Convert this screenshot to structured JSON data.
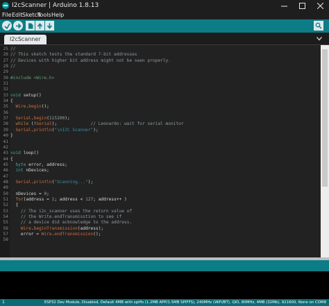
{
  "window": {
    "title": "I2cScanner | Arduino 1.8.13"
  },
  "menu": {
    "items": [
      "File",
      "Edit",
      "Sketch",
      "Tools",
      "Help"
    ]
  },
  "toolbar": {
    "buttons": [
      {
        "name": "verify",
        "icon": "checkmark-icon"
      },
      {
        "name": "upload",
        "icon": "arrow-right-icon"
      },
      {
        "name": "new",
        "icon": "new-file-icon"
      },
      {
        "name": "open",
        "icon": "arrow-up-icon"
      },
      {
        "name": "save",
        "icon": "arrow-down-icon"
      }
    ],
    "right_icon": "serial-monitor-icon"
  },
  "tabs": {
    "active": "I2cScanner"
  },
  "editor": {
    "lines": [
      {
        "n": "25",
        "code": "//",
        "kind": "comment"
      },
      {
        "n": "26",
        "code": "// This sketch tests the standard 7-bit addresses",
        "kind": "comment"
      },
      {
        "n": "27",
        "code": "// Devices with higher bit address might not be seen properly.",
        "kind": "comment"
      },
      {
        "n": "28",
        "code": "//",
        "kind": "comment"
      },
      {
        "n": "29",
        "code": "",
        "kind": "plain"
      },
      {
        "n": "30",
        "code": "#include <Wire.h>",
        "kind": "preproc"
      },
      {
        "n": "31",
        "code": "",
        "kind": "plain"
      },
      {
        "n": "32",
        "code": "",
        "kind": "plain"
      },
      {
        "n": "33",
        "code": "void setup()",
        "kind": "decl"
      },
      {
        "n": "34",
        "code": "{",
        "kind": "plain"
      },
      {
        "n": "35",
        "code": "  Wire.begin();",
        "kind": "call"
      },
      {
        "n": "36",
        "code": "",
        "kind": "plain"
      },
      {
        "n": "37",
        "code": "  Serial.begin(115200);",
        "kind": "call"
      },
      {
        "n": "38",
        "code": "  while (!Serial);             // Leonardo: wait for serial monitor",
        "kind": "loop"
      },
      {
        "n": "39",
        "code": "  Serial.println(\"\\nI2C Scanner\");",
        "kind": "call"
      },
      {
        "n": "40",
        "code": "}",
        "kind": "plain"
      },
      {
        "n": "41",
        "code": "",
        "kind": "plain"
      },
      {
        "n": "42",
        "code": "",
        "kind": "plain"
      },
      {
        "n": "43",
        "code": "void loop()",
        "kind": "decl"
      },
      {
        "n": "44",
        "code": "{",
        "kind": "plain"
      },
      {
        "n": "45",
        "code": "  byte error, address;",
        "kind": "type"
      },
      {
        "n": "46",
        "code": "  int nDevices;",
        "kind": "type"
      },
      {
        "n": "47",
        "code": "",
        "kind": "plain"
      },
      {
        "n": "48",
        "code": "  Serial.println(\"Scanning...\");",
        "kind": "call"
      },
      {
        "n": "49",
        "code": "",
        "kind": "plain"
      },
      {
        "n": "50",
        "code": "  nDevices = 0;",
        "kind": "plain"
      },
      {
        "n": "51",
        "code": "  for(address = 1; address < 127; address++ )",
        "kind": "loop"
      },
      {
        "n": "52",
        "code": "  {",
        "kind": "plain"
      },
      {
        "n": "53",
        "code": "    // The i2c_scanner uses the return value of",
        "kind": "comment"
      },
      {
        "n": "54",
        "code": "    // the Write.endTransmisstion to see if",
        "kind": "comment"
      },
      {
        "n": "55",
        "code": "    // a device did acknowledge to the address.",
        "kind": "comment"
      },
      {
        "n": "56",
        "code": "    Wire.beginTransmission(address);",
        "kind": "call"
      },
      {
        "n": "57",
        "code": "    error = Wire.endTransmission();",
        "kind": "call"
      },
      {
        "n": "58",
        "code": "",
        "kind": "plain"
      }
    ]
  },
  "status": {
    "line_number": "1",
    "board_info": "ESP32 Dev Module, Disabled, Default 4MB with spiffs (1.2MB APP/1.5MB SPIFFS), 240MHz (WiFi/BT), QIO, 80MHz, 4MB (32Mb), 921600, None on COM8"
  },
  "colors": {
    "toolbar": "#0c7d86",
    "editor_bg": "#222222",
    "statusbar": "#0a6c75"
  }
}
